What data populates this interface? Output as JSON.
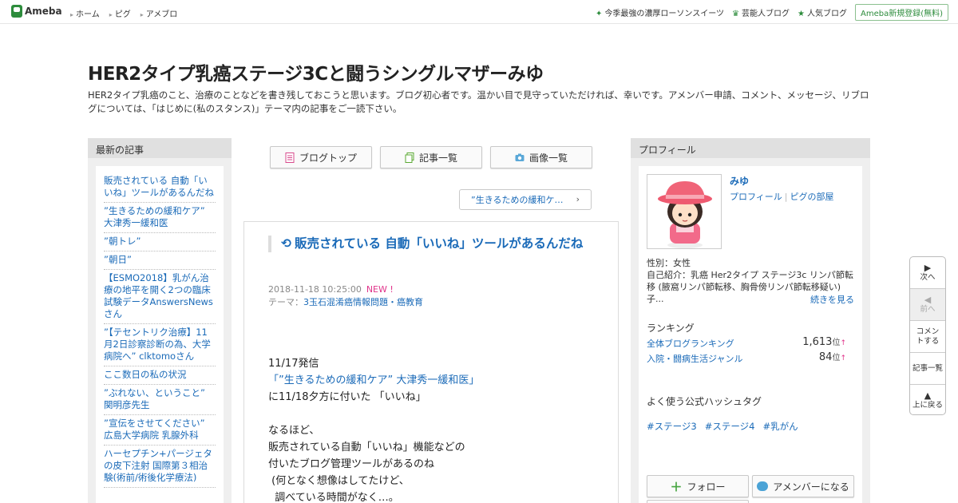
{
  "topbar": {
    "logo": "Ameba",
    "nav": [
      "ホーム",
      "ピグ",
      "アメブロ"
    ],
    "right": [
      "今季最強の濃厚ローソンスイーツ",
      "芸能人ブログ",
      "人気ブログ"
    ],
    "signup": "Ameba新規登録(無料)"
  },
  "blog": {
    "title": "HER2タイプ乳癌ステージ3Cと闘うシングルマザーみゆ",
    "description": "HER2タイプ乳癌のこと、治療のことなどを書き残しておこうと思います。ブログ初心者です。温かい目で見守っていただければ、幸いです。アメンバー申請、コメント、メッセージ、リブログについては、「はじめに(私のスタンス)」テーマ内の記事をご一読下さい。"
  },
  "sidebar_left": {
    "heading": "最新の記事",
    "items": [
      "販売されている 自動「いいね」ツールがあるんだね",
      "”生きるための緩和ケア” 大津秀一緩和医",
      "”朝トレ”",
      "”朝日”",
      "【ESMO2018】乳がん治療の地平を開く2つの臨床試験データAnswersNewsさん",
      "”【テセントリク治療】11月2日診察診断の為、大学病院へ” clktomoさん",
      "ここ数日の私の状況",
      "”ぶれない、ということ” 関明彦先生",
      "”宣伝をさせてください” 広島大学病院 乳腺外科",
      "ハーセプチン+パージェタの皮下注射 国際第３相治験(術前/術後化学療法)"
    ]
  },
  "tabs": {
    "blog_top": "ブログトップ",
    "articles": "記事一覧",
    "images": "画像一覧"
  },
  "prev_article": "”生きるための緩和ケ…",
  "article": {
    "title": "販売されている 自動「いいね」ツールがあるんだね",
    "date": "2018-11-18 10:25:00",
    "new_badge": "NEW !",
    "theme_label": "テーマ：",
    "theme": "3玉石混淆癌情報問題・癌教育",
    "body": {
      "l1": "11/17発信",
      "l2": "「”生きるための緩和ケア” 大津秀一緩和医」",
      "l3": "に11/18夕方に付いた 「いいね」",
      "l4": "なるほど、",
      "l5": "販売されている自動「いいね」機能などの",
      "l6": "付いたブログ管理ツールがあるのね",
      "l7": " (何となく想像はしてたけど、",
      "l8": "  調べている時間がなく…。"
    }
  },
  "profile": {
    "heading": "プロフィール",
    "name": "みゆ",
    "link_profile": "プロフィール",
    "link_pig": "ピグの部屋",
    "gender": "性別：女性",
    "intro": "自己紹介：乳癌 Her2タイプ ステージ3c リンパ節転移 (腋窩リンパ節転移、胸骨傍リンパ節転移疑い) 子...",
    "more": "続きを見る",
    "ranking_heading": "ランキング",
    "rank1_label": "全体ブログランキング",
    "rank1_value": "1,613",
    "rank2_label": "入院・闘病生活ジャンル",
    "rank2_value": "84",
    "rank_unit": "位",
    "rank_arrow": "↑",
    "hashtag_heading": "よく使う公式ハッシュタグ",
    "tags": [
      "#ステージ3",
      "#ステージ4",
      "#乳がん"
    ],
    "follow": "フォロー",
    "member": "アメンバーになる"
  },
  "floatnav": {
    "next": "次へ",
    "prev": "前へ",
    "comment": "コメントする",
    "list": "記事一覧",
    "top": "上に戻る"
  },
  "colors": {
    "link": "#1a6ab8",
    "brand_green": "#2d8c3c",
    "new_pink": "#e0338a"
  }
}
